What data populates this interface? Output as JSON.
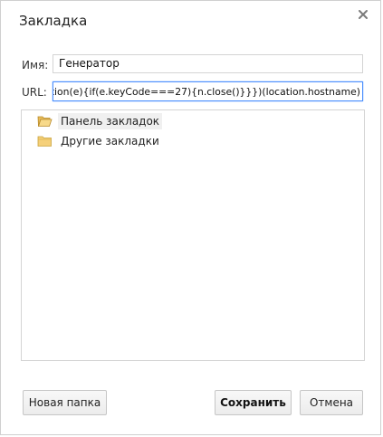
{
  "dialog": {
    "title": "Закладка",
    "close_icon": "close-icon"
  },
  "form": {
    "name_label": "Имя:",
    "name_value": "Генератор",
    "url_label": "URL:",
    "url_value": "javascript:(function(){var n=window.open('');n.document.onkeydown=function(e){if(e.keyCode===27){n.close()}}})(location.hostname)"
  },
  "tree": {
    "items": [
      {
        "label": "Панель закладок",
        "icon": "folder-open-icon",
        "selected": true
      },
      {
        "label": "Другие закладки",
        "icon": "folder-icon",
        "selected": false
      }
    ]
  },
  "buttons": {
    "new_folder": "Новая папка",
    "save": "Сохранить",
    "cancel": "Отмена"
  },
  "colors": {
    "focus_border": "#4d90fe",
    "folder_fill": "#f5d07a",
    "folder_stroke": "#c9a23d"
  }
}
